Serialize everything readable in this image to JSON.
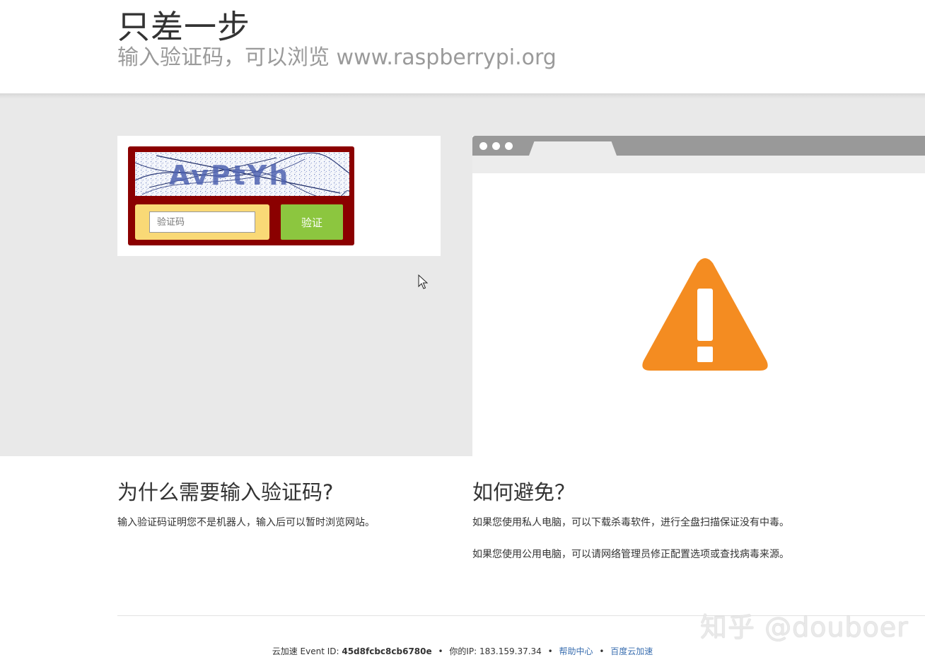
{
  "header": {
    "title": "只差一步",
    "subtitle": "输入验证码，可以浏览 www.raspberrypi.org"
  },
  "captcha": {
    "image_text": "AvPtYh",
    "input_placeholder": "验证码",
    "input_value": "",
    "verify_label": "验证"
  },
  "browser_mock": {
    "icon": "warning-triangle-icon",
    "warning_color": "#f48c21"
  },
  "why_section": {
    "heading": "为什么需要输入验证码?",
    "body": "输入验证码证明您不是机器人，输入后可以暂时浏览网站。"
  },
  "avoid_section": {
    "heading": "如何避免？",
    "paragraphs": [
      "如果您使用私人电脑，可以下载杀毒软件，进行全盘扫描保证没有中毒。",
      "如果您使用公用电脑，可以请网络管理员修正配置选项或查找病毒来源。"
    ]
  },
  "footer": {
    "event_prefix": "云加速 Event ID: ",
    "event_id": "45d8fcbc8cb6780e",
    "ip_prefix": "你的IP: ",
    "ip": "183.159.37.34",
    "help_link": "帮助中心",
    "baidu_link": "百度云加速",
    "separator": "•"
  },
  "watermark": "知乎 @douboer",
  "colors": {
    "captcha_frame": "#8b0000",
    "input_bg": "#f9d976",
    "verify_button": "#8cc63f",
    "gray_band": "#e9e9e9",
    "link": "#3b6fb0"
  }
}
